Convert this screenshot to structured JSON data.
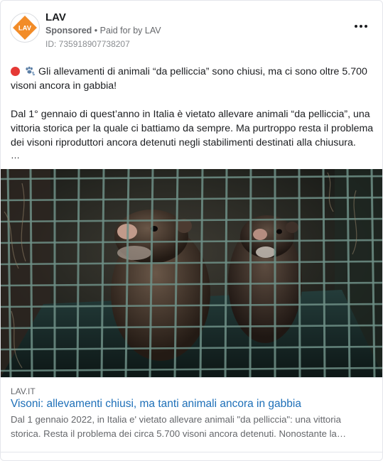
{
  "ad": {
    "page_name": "LAV",
    "logo_text": "LAV",
    "sponsored_label": "Sponsored",
    "separator": "•",
    "paid_for_prefix": "Paid for by",
    "paid_for_name": "LAV",
    "ad_id": "ID: 735918907738207",
    "brand_color": "#f28c28"
  },
  "post": {
    "line1": "Gli allevamenti di animali “da pelliccia” sono chiusi, ma ci sono oltre 5.700 visoni ancora in gabbia!",
    "paragraph2": "Dal 1° gennaio di quest’anno in Italia è vietato allevare animali “da pelliccia”, una vittoria storica per la quale ci battiamo da sempre. Ma purtroppo resta il problema dei visoni riproduttori ancora detenuti negli stabilimenti destinati alla chiusura.",
    "ellipsis": "…",
    "emoji_icons": [
      "red-circle-icon",
      "paw-prints-icon"
    ]
  },
  "link_preview": {
    "domain": "LAV.IT",
    "headline": "Visoni: allevamenti chiusi, ma tanti animali ancora in gabbia",
    "description": "Dal 1 gennaio 2022, in Italia e' vietato allevare animali \"da pelliccia\": una vittoria storica. Resta il problema dei circa 5.700 visoni ancora detenuti. Nonostante la…"
  }
}
